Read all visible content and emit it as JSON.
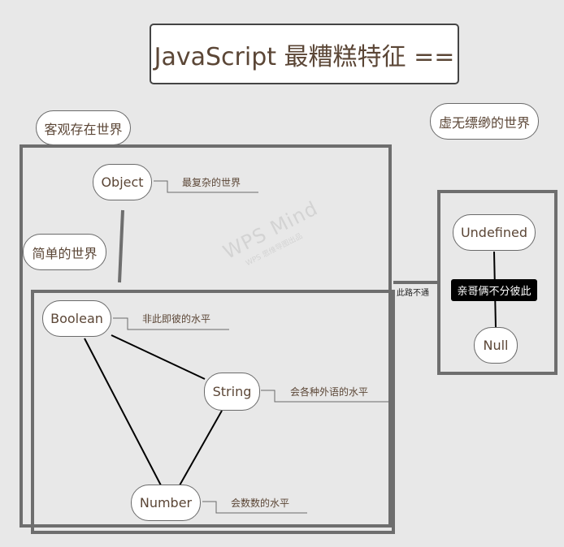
{
  "title": "JavaScript 最糟糕特征 ==",
  "nodes": {
    "objective_world": "客观存在世界",
    "illusory_world": "虚无缥缈的世界",
    "object": "Object",
    "simple_world": "简单的世界",
    "undefined": "Undefined",
    "null": "Null",
    "boolean": "Boolean",
    "string": "String",
    "number": "Number"
  },
  "notes": {
    "object_note": "最复杂的世界",
    "boolean_note": "非此即彼的水平",
    "string_note": "会各种外语的水平",
    "number_note": "会数数的水平"
  },
  "labels": {
    "no_passage": "此路不通",
    "inseparable": "亲哥俩不分彼此"
  },
  "watermark": {
    "brand": "WPS Mind",
    "tagline": "WPS 思维导图出品"
  }
}
